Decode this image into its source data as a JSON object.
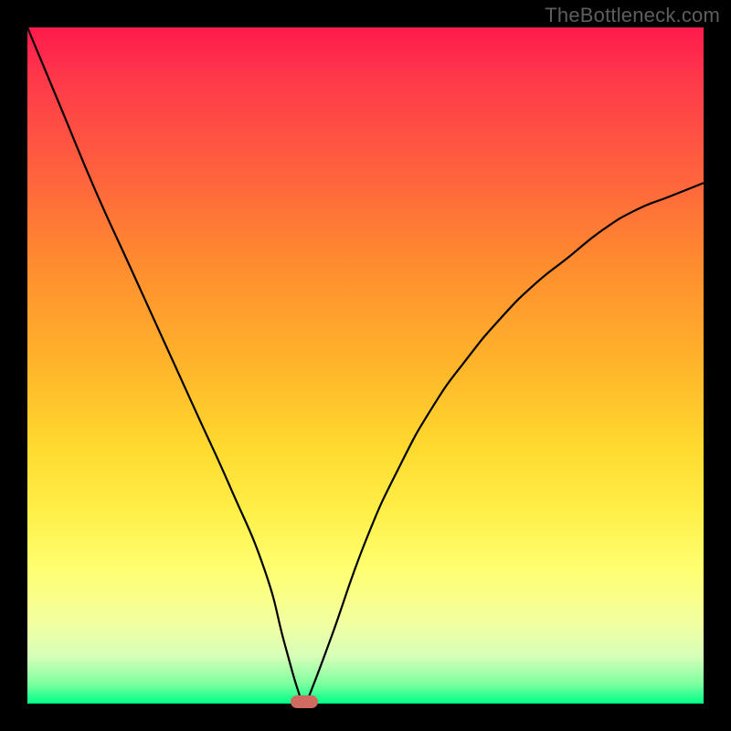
{
  "watermark": "TheBottleneck.com",
  "chart_data": {
    "type": "line",
    "title": "",
    "xlabel": "",
    "ylabel": "",
    "xlim": [
      0,
      100
    ],
    "ylim": [
      0,
      100
    ],
    "x": [
      0,
      5,
      10,
      15,
      20,
      25,
      30,
      35,
      38,
      40,
      41,
      42,
      45,
      50,
      55,
      60,
      65,
      70,
      75,
      80,
      85,
      90,
      95,
      100
    ],
    "values": [
      100,
      88,
      76,
      65,
      54,
      43,
      32,
      20,
      9,
      2,
      0,
      2,
      10,
      24,
      35,
      44,
      51,
      57,
      62,
      66,
      70,
      73,
      75,
      77
    ],
    "series_name": "bottleneck-curve",
    "optimum_x": 41,
    "optimum_y": 0,
    "gradient_stops": [
      {
        "pos": 0.0,
        "color": "#ff1a4d"
      },
      {
        "pos": 0.5,
        "color": "#ffd92e"
      },
      {
        "pos": 0.8,
        "color": "#ffff70"
      },
      {
        "pos": 1.0,
        "color": "#00ff88"
      }
    ]
  }
}
